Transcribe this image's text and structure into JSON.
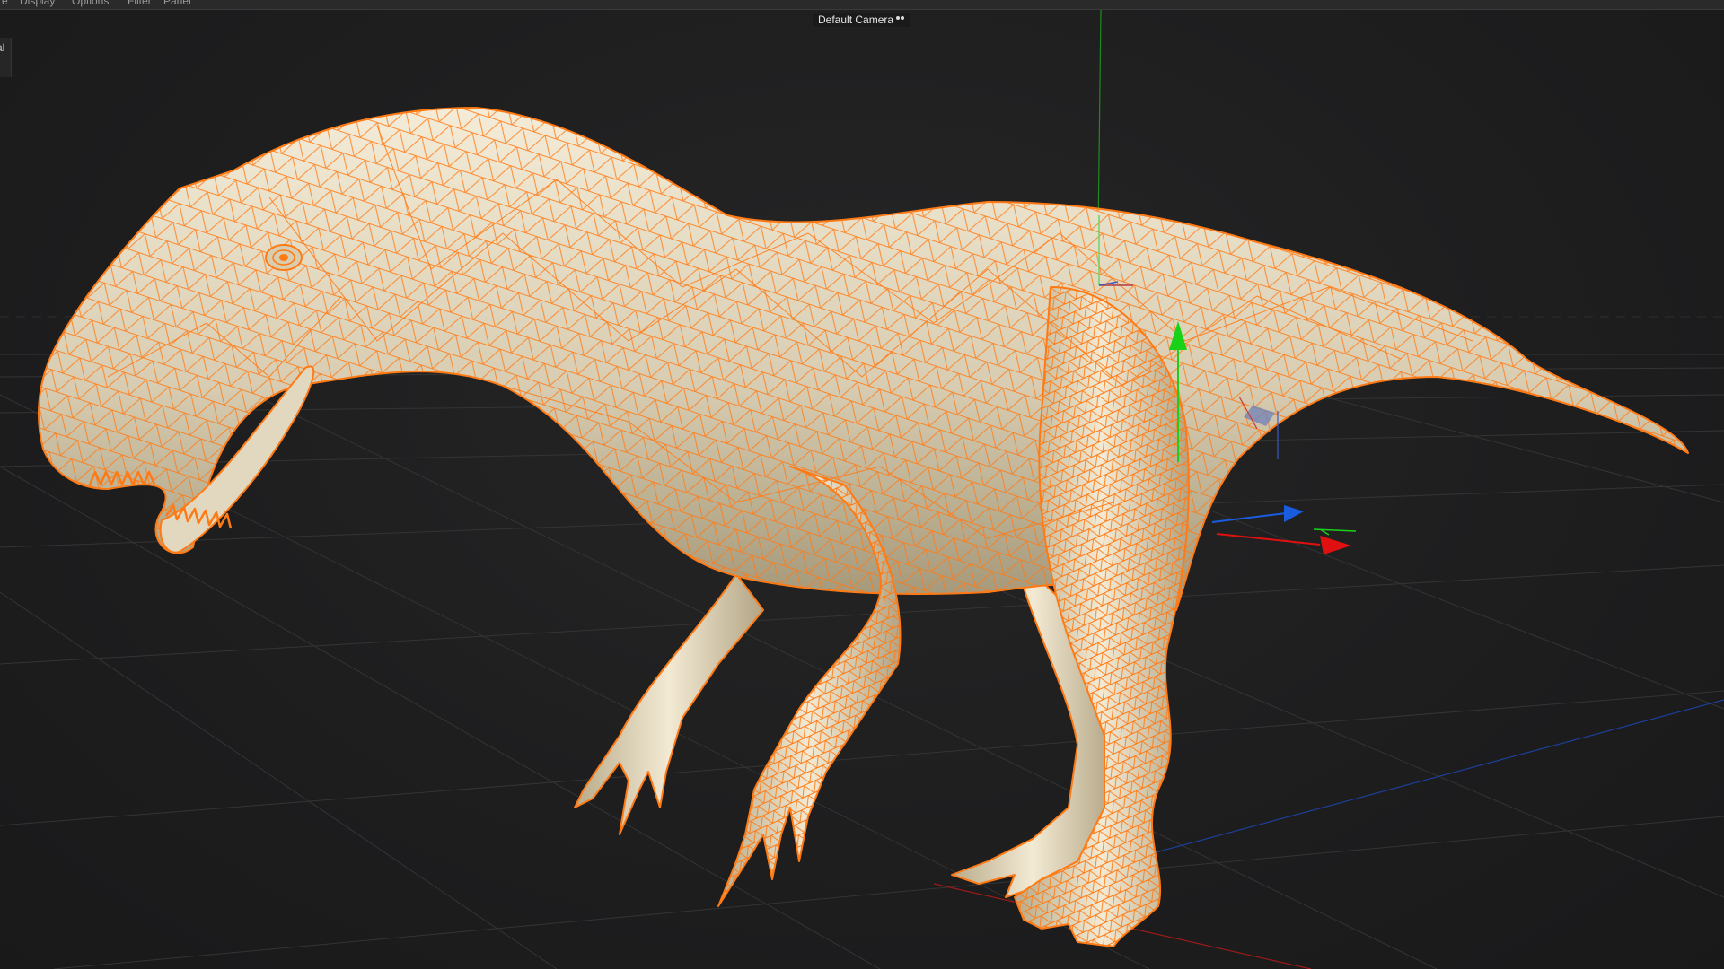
{
  "viewport": {
    "camera_label": "Default Camera",
    "camera_icon": "camera-link-icon",
    "side_tab_label": "al",
    "colors": {
      "background": "#1d1d1e",
      "grid": "#353535",
      "wireframe": "#ff7a14",
      "surface": "#e9e1cd",
      "axis_x": "#e01010",
      "axis_y": "#19d119",
      "axis_z": "#1a5ce0"
    }
  },
  "menubar": {
    "items": [
      "e",
      "Display",
      "Options",
      "Filter",
      "Panel"
    ]
  }
}
